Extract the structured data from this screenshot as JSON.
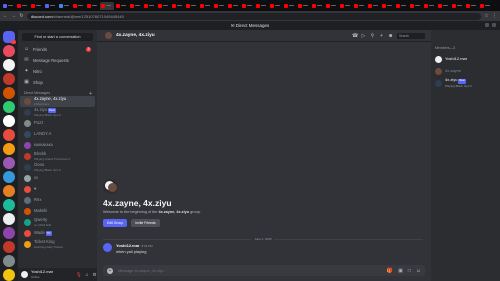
{
  "browser": {
    "url_host": "discord.com",
    "url_path": "/channels/@me/1251076071049445440",
    "tab_favicon_colors": [
      "#5865f2",
      "#ff0000",
      "#ff0000",
      "#5865f2",
      "#4285f4",
      "#ff0000",
      "#ff0000",
      "#ff0000",
      "#ff0000",
      "#ff0000",
      "#ff0000",
      "#ff0000",
      "#ff0000",
      "#ff0000",
      "#ff0000",
      "#ff0000",
      "#ff0000",
      "#ff0000",
      "#ff0000",
      "#ff0000",
      "#ff0000",
      "#ff0000",
      "#ff0000",
      "#ff0000",
      "#ff0000",
      "#ff0000",
      "#ff0000",
      "#ff0000",
      "#ff0000",
      "#ff0000",
      "#ff0000",
      "#ff0000",
      "#ff0000",
      "#ff0000",
      "#ff0000"
    ]
  },
  "topbar": {
    "title": "Direct Messages"
  },
  "servers": [
    {
      "color": "#5865f2",
      "kind": "home",
      "badge": true
    },
    {
      "color": "#e84a5f"
    },
    {
      "color": "#f5f5f5"
    },
    {
      "color": "#c0392b"
    },
    {
      "color": "#d35400"
    },
    {
      "color": "#2ecc71"
    },
    {
      "color": "#ffffff"
    },
    {
      "color": "#e74c3c"
    },
    {
      "color": "#f39c12"
    },
    {
      "color": "#9b59b6"
    },
    {
      "color": "#3498db"
    },
    {
      "color": "#e67e22"
    },
    {
      "color": "#1abc9c"
    },
    {
      "color": "#ecf0f1"
    },
    {
      "color": "#8e44ad"
    },
    {
      "color": "#c0392b"
    },
    {
      "color": "#7f8c8d"
    },
    {
      "color": "#f1c40f"
    },
    {
      "color": "#e74c3c"
    }
  ],
  "sidebar": {
    "search_label": "Find or start a conversation",
    "nav": [
      {
        "icon": "☺",
        "label": "Friends",
        "badge": "3"
      },
      {
        "icon": "✉",
        "label": "Message Requests"
      },
      {
        "icon": "✦",
        "label": "Nitro"
      },
      {
        "icon": "▣",
        "label": "Shop"
      }
    ],
    "dm_header": "Direct Messages",
    "dms": [
      {
        "name": "4x.zayne, 4x.ziyu",
        "sub": "2 Members",
        "color": "#6b4b3e",
        "selected": true
      },
      {
        "name": "4x.ziyu",
        "tag": "Beat",
        "sub": "Playing Black Ops 6",
        "color": "#2c3e50"
      },
      {
        "name": "Pozz",
        "color": "#7f8c8d"
      },
      {
        "name": "LANDY.A",
        "color": "#34495e"
      },
      {
        "name": "ᴋᴀᴋᴋᴀᴋᴀᴋᴀ",
        "color": "#8e44ad"
      },
      {
        "name": "Blvckk",
        "sub": "Playing Grand Theft Auto V",
        "color": "#c0392b"
      },
      {
        "name": "Oooo",
        "sub": "Playing Black Ops 6",
        "color": "#2c3e50"
      },
      {
        "name": "vc",
        "color": "#95a5a6"
      },
      {
        "name": "♥",
        "color": "#e74c3c"
      },
      {
        "name": "Rex",
        "color": "#5d6d7e"
      },
      {
        "name": "Makshi",
        "color": "#d35400"
      },
      {
        "name": "Qwerty",
        "sub": "on 2K24 Edit",
        "color": "#16a085"
      },
      {
        "name": "Wade",
        "tag": "TR",
        "color": "#e74c3c"
      },
      {
        "name": "Ticket King",
        "sub": "watching daily Tickets",
        "color": "#f39c12"
      }
    ]
  },
  "user": {
    "name": "Yoshi12.mar",
    "status": "Online",
    "color": "#ecf0f1"
  },
  "chat": {
    "title": "4x.zayne, 4x.ziyu",
    "search_placeholder": "Search",
    "welcome_title": "4x.zayne, 4x.ziyu",
    "welcome_prefix": "Welcome to the beginning of the ",
    "welcome_group": "4x.zayne, 4x.ziyu",
    "welcome_suffix": " group.",
    "edit_group": "Edit Group",
    "invite_friends": "Invite Friends",
    "date_divider": "June 1, 2025",
    "message": {
      "author": "Yoshi12.mar",
      "time": "8:04 PM",
      "text": "when yall playing"
    },
    "composer_placeholder": "Message 4x.zayne, 4x.ziyu"
  },
  "members": {
    "header": "Members—3",
    "list": [
      {
        "name": "Yoshi12.mar",
        "color": "#ecf0f1"
      },
      {
        "name": "4x.zayne",
        "dim": true,
        "color": "#6b4b3e"
      },
      {
        "name": "4x.ziyu",
        "tag": "Beat",
        "sub": "Playing Black Ops 6",
        "color": "#2c3e50"
      }
    ]
  }
}
